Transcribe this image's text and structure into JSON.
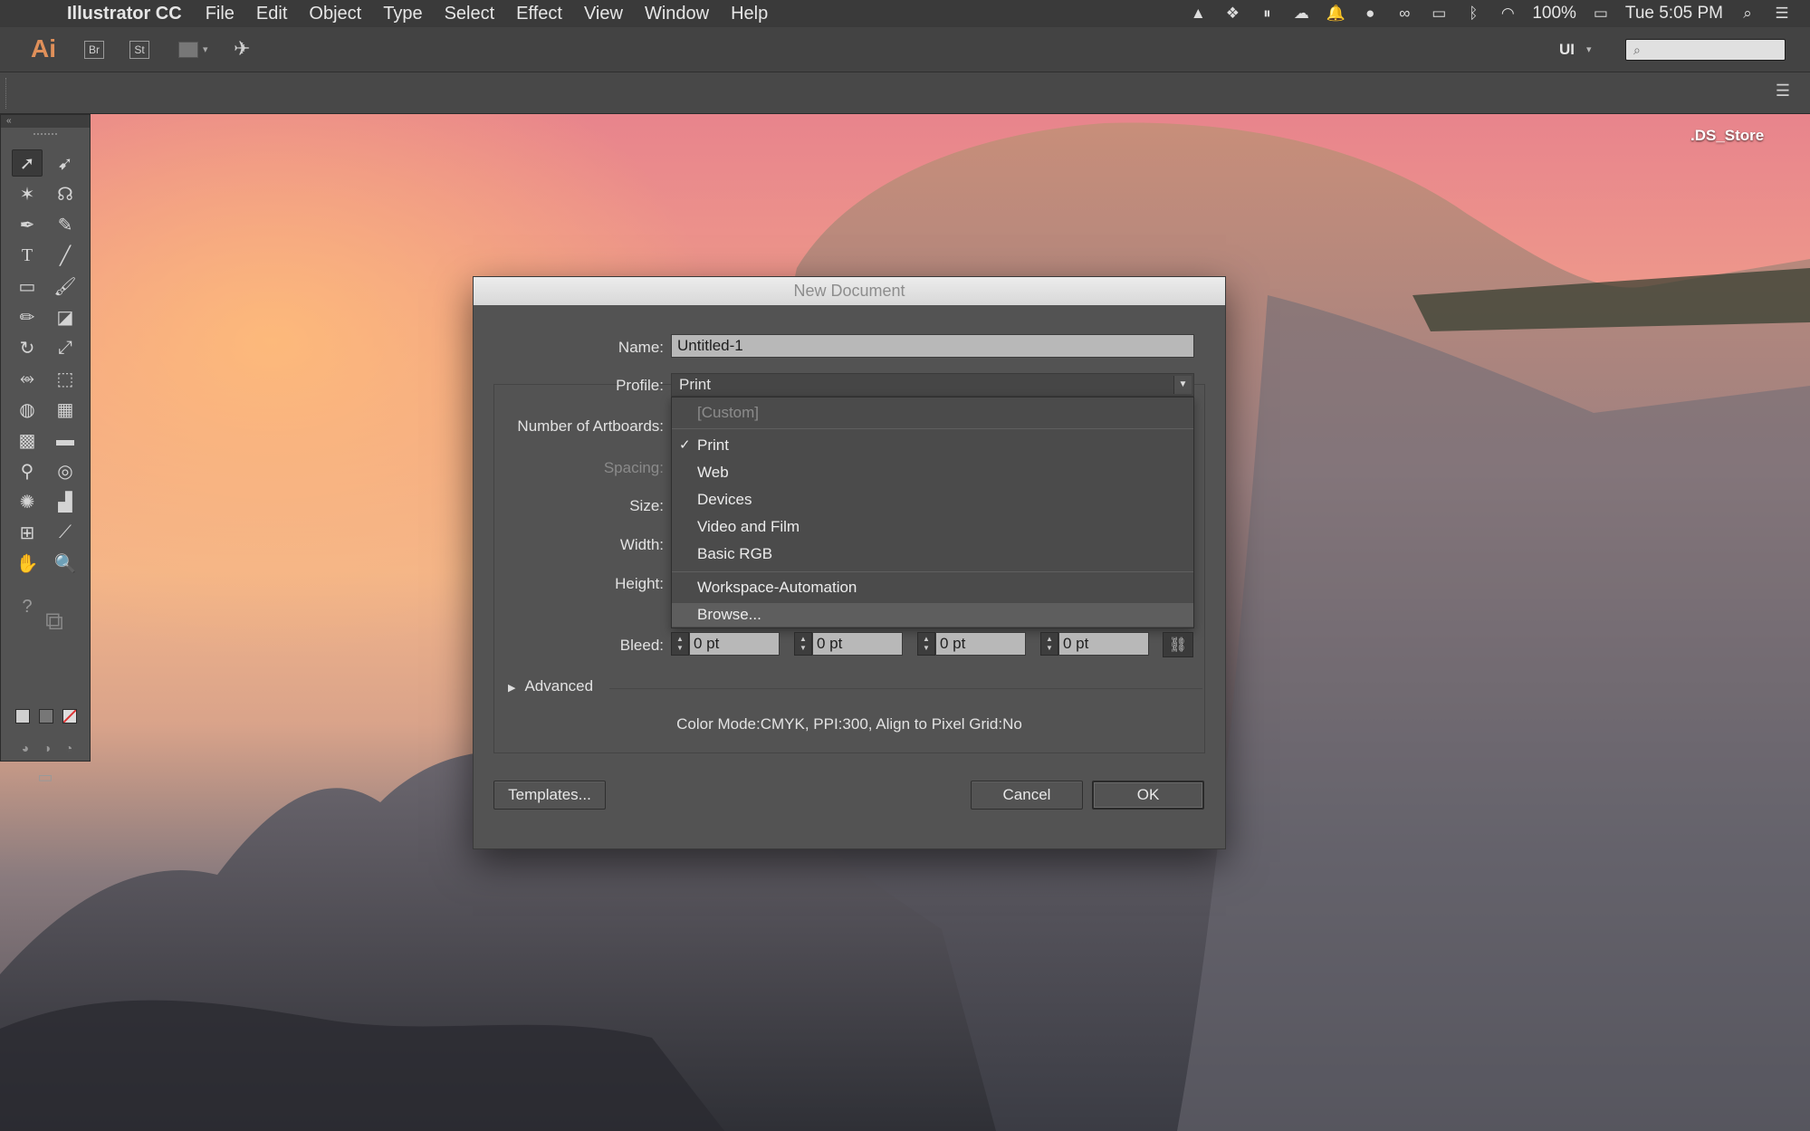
{
  "menubar": {
    "app_name": "Illustrator CC",
    "items": [
      "File",
      "Edit",
      "Object",
      "Type",
      "Select",
      "Effect",
      "View",
      "Window",
      "Help"
    ],
    "battery": "100%",
    "clock": "Tue 5:05 PM"
  },
  "appbar": {
    "logo": "Ai",
    "bridge": "Br",
    "stock": "St",
    "workspace": "UI"
  },
  "desktop": {
    "file_name": ".DS_Store"
  },
  "dialog": {
    "title": "New Document",
    "name_label": "Name:",
    "name_value": "Untitled-1",
    "profile_label": "Profile:",
    "profile_value": "Print",
    "artboards_label": "Number of Artboards:",
    "spacing_label": "Spacing:",
    "size_label": "Size:",
    "width_label": "Width:",
    "height_label": "Height:",
    "bleed_label": "Bleed:",
    "bleed_values": [
      "0 pt",
      "0 pt",
      "0 pt",
      "0 pt"
    ],
    "advanced_label": "Advanced",
    "summary": "Color Mode:CMYK, PPI:300, Align to Pixel Grid:No",
    "templates_button": "Templates...",
    "cancel_button": "Cancel",
    "ok_button": "OK",
    "profile_options": [
      "[Custom]",
      "Print",
      "Web",
      "Devices",
      "Video and Film",
      "Basic RGB",
      "Workspace-Automation",
      "Browse..."
    ]
  }
}
